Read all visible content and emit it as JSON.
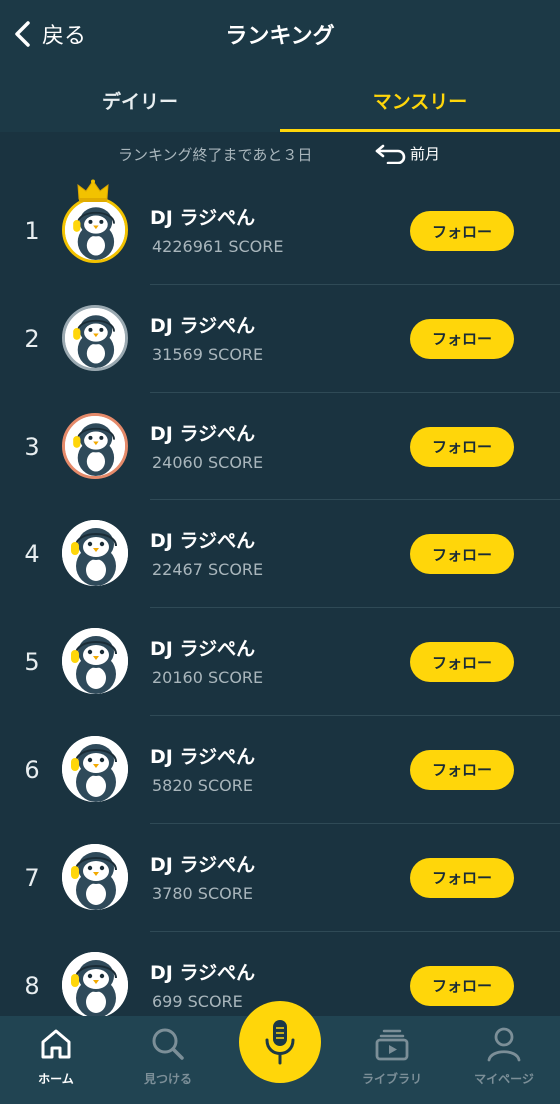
{
  "header": {
    "back_label": "戻る",
    "title": "ランキング"
  },
  "tabs": [
    {
      "label": "デイリー",
      "active": false
    },
    {
      "label": "マンスリー",
      "active": true
    }
  ],
  "info": {
    "remaining": "ランキング終了まであと３日",
    "prev_label": "前月"
  },
  "rows": [
    {
      "rank": "1",
      "name": "DJ ラジぺん",
      "score": "4226961 SCORE",
      "follow": "フォロー",
      "frame": "gold",
      "crown": true
    },
    {
      "rank": "2",
      "name": "DJ ラジぺん",
      "score": "31569 SCORE",
      "follow": "フォロー",
      "frame": "silver"
    },
    {
      "rank": "3",
      "name": "DJ ラジぺん",
      "score": "24060 SCORE",
      "follow": "フォロー",
      "frame": "bronze"
    },
    {
      "rank": "4",
      "name": "DJ ラジぺん",
      "score": "22467 SCORE",
      "follow": "フォロー",
      "frame": "none"
    },
    {
      "rank": "5",
      "name": "DJ ラジぺん",
      "score": "20160 SCORE",
      "follow": "フォロー",
      "frame": "none"
    },
    {
      "rank": "6",
      "name": "DJ ラジぺん",
      "score": "5820 SCORE",
      "follow": "フォロー",
      "frame": "none"
    },
    {
      "rank": "7",
      "name": "DJ ラジぺん",
      "score": "3780 SCORE",
      "follow": "フォロー",
      "frame": "none"
    },
    {
      "rank": "8",
      "name": "DJ ラジぺん",
      "score": "699 SCORE",
      "follow": "フォロー",
      "frame": "none"
    }
  ],
  "tabbar": {
    "home": "ホーム",
    "discover": "見つける",
    "library": "ライブラリ",
    "mypage": "マイページ"
  },
  "colors": {
    "accent": "#ffd60a",
    "background": "#1a3340",
    "bar": "#214452"
  }
}
